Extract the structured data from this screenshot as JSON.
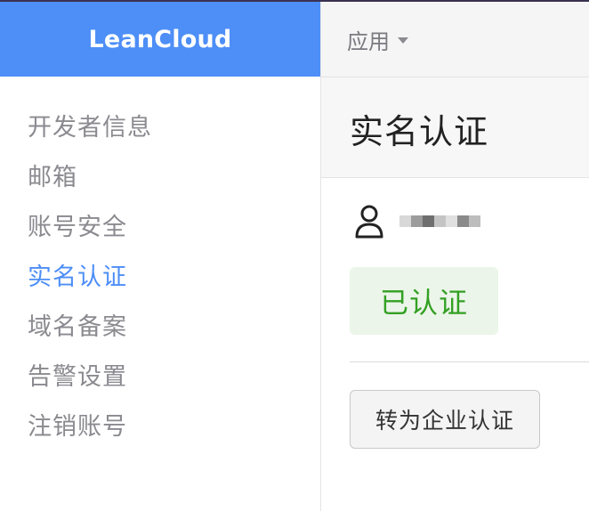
{
  "brand": {
    "name": "LeanCloud",
    "color": "#4d8ef7"
  },
  "sidebar": {
    "items": [
      {
        "label": "开发者信息",
        "active": false
      },
      {
        "label": "邮箱",
        "active": false
      },
      {
        "label": "账号安全",
        "active": false
      },
      {
        "label": "实名认证",
        "active": true
      },
      {
        "label": "域名备案",
        "active": false
      },
      {
        "label": "告警设置",
        "active": false
      },
      {
        "label": "注销账号",
        "active": false
      }
    ]
  },
  "topbar": {
    "app_menu_label": "应用",
    "app_menu_icon": "caret-down-icon"
  },
  "page": {
    "title": "实名认证",
    "user_icon": "user-icon",
    "status_badge": "已认证",
    "status_color": "#33a023",
    "convert_button": "转为企业认证"
  }
}
